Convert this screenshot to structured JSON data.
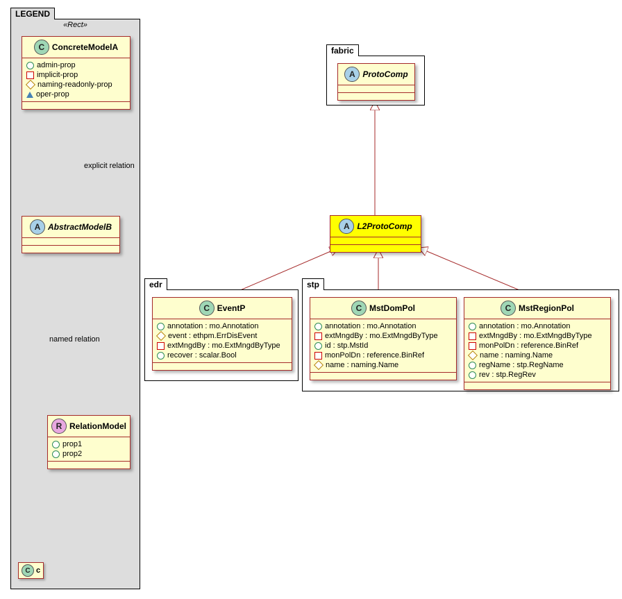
{
  "legend": {
    "title": "LEGEND",
    "stereotype": "«Rect»",
    "concreteA": {
      "name": "ConcreteModelA",
      "props": [
        {
          "sym": "circle-green",
          "text": "admin-prop"
        },
        {
          "sym": "square-red",
          "text": "implicit-prop"
        },
        {
          "sym": "diamond-gold",
          "text": "naming-readonly-prop"
        },
        {
          "sym": "triangle-blue",
          "text": "oper-prop"
        }
      ]
    },
    "abstractB": {
      "name": "AbstractModelB"
    },
    "relationModel": {
      "name": "RelationModel",
      "props": [
        {
          "sym": "circle-green",
          "text": "prop1"
        },
        {
          "sym": "circle-green",
          "text": "prop2"
        }
      ]
    },
    "cClass": {
      "name": "c"
    },
    "relExplicit": "explicit relation",
    "relNamed": "named relation"
  },
  "fabric": {
    "title": "fabric",
    "protoComp": {
      "name": "ProtoComp"
    },
    "l2ProtoComp": {
      "name": "L2ProtoComp"
    }
  },
  "edr": {
    "title": "edr",
    "eventP": {
      "name": "EventP",
      "props": [
        {
          "sym": "circle-green",
          "text": "annotation : mo.Annotation"
        },
        {
          "sym": "diamond-gold",
          "text": "event : ethpm.ErrDisEvent"
        },
        {
          "sym": "square-red",
          "text": "extMngdBy : mo.ExtMngdByType"
        },
        {
          "sym": "circle-green",
          "text": "recover : scalar.Bool"
        }
      ]
    }
  },
  "stp": {
    "title": "stp",
    "mstDomPol": {
      "name": "MstDomPol",
      "props": [
        {
          "sym": "circle-green",
          "text": "annotation : mo.Annotation"
        },
        {
          "sym": "square-red",
          "text": "extMngdBy : mo.ExtMngdByType"
        },
        {
          "sym": "circle-green",
          "text": "id : stp.MstId"
        },
        {
          "sym": "square-red",
          "text": "monPolDn : reference.BinRef"
        },
        {
          "sym": "diamond-gold",
          "text": "name : naming.Name"
        }
      ]
    },
    "mstRegionPol": {
      "name": "MstRegionPol",
      "props": [
        {
          "sym": "circle-green",
          "text": "annotation : mo.Annotation"
        },
        {
          "sym": "square-red",
          "text": "extMngdBy : mo.ExtMngdByType"
        },
        {
          "sym": "square-red",
          "text": "monPolDn : reference.BinRef"
        },
        {
          "sym": "diamond-gold",
          "text": "name : naming.Name"
        },
        {
          "sym": "circle-green",
          "text": "regName : stp.RegName"
        },
        {
          "sym": "circle-green",
          "text": "rev : stp.RegRev"
        }
      ]
    }
  }
}
